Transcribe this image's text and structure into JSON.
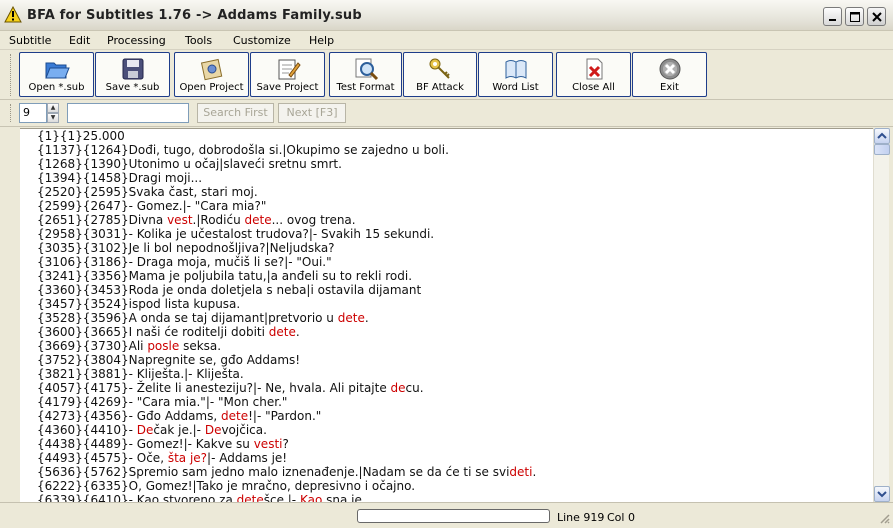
{
  "window": {
    "title": "BFA for Subtitles 1.76 -> Addams Family.sub"
  },
  "menu": [
    "Subtitle",
    "Edit",
    "Processing",
    "Tools",
    "Customize",
    "Help"
  ],
  "toolbar": {
    "buttons": [
      {
        "label": "Open *.sub",
        "icon": "folder-open-icon"
      },
      {
        "label": "Save *.sub",
        "icon": "floppy-disk-icon"
      },
      {
        "label": "Open Project",
        "icon": "open-project-icon"
      },
      {
        "label": "Save Project",
        "icon": "save-project-icon"
      },
      {
        "label": "Test Format",
        "icon": "magnifier-icon"
      },
      {
        "label": "BF Attack",
        "icon": "key-icon"
      },
      {
        "label": "Word List",
        "icon": "book-icon"
      },
      {
        "label": "Close All",
        "icon": "close-document-icon"
      },
      {
        "label": "Exit",
        "icon": "exit-icon"
      }
    ]
  },
  "search": {
    "spin_value": "9",
    "query": "",
    "search_first_label": "Search First",
    "next_label": "Next [F3]"
  },
  "editor": {
    "lines": [
      [
        {
          "t": "{1}{1}25.000"
        }
      ],
      [
        {
          "t": "{1137}{1264}Dođi, tugo, dobrodošla si.|Okupimo se zajedno u boli."
        }
      ],
      [
        {
          "t": "{1268}{1390}Utonimo u očaj|slaveći sretnu smrt."
        }
      ],
      [
        {
          "t": "{1394}{1458}Dragi moji..."
        }
      ],
      [
        {
          "t": "{2520}{2595}Svaka čast, stari moj."
        }
      ],
      [
        {
          "t": "{2599}{2647}- Gomez.|- \"Cara mia?\""
        }
      ],
      [
        {
          "t": "{2651}{2785}Divna "
        },
        {
          "t": "vest",
          "h": true
        },
        {
          "t": ".|Rodiću "
        },
        {
          "t": "dete",
          "h": true
        },
        {
          "t": "... ovog trena."
        }
      ],
      [
        {
          "t": "{2958}{3031}- Kolika je učestalost trudova?|- Svakih 15 sekundi."
        }
      ],
      [
        {
          "t": "{3035}{3102}Je li bol nepodnošljiva?|Neljudska?"
        }
      ],
      [
        {
          "t": "{3106}{3186}- Draga moja, mučiš li se?|- \"Oui.\""
        }
      ],
      [
        {
          "t": "{3241}{3356}Mama je poljubila tatu,|a anđeli su to rekli rodi."
        }
      ],
      [
        {
          "t": "{3360}{3453}Roda je onda doletjela s neba|i ostavila dijamant"
        }
      ],
      [
        {
          "t": "{3457}{3524}ispod lista kupusa."
        }
      ],
      [
        {
          "t": "{3528}{3596}A onda se taj dijamant|pretvorio u "
        },
        {
          "t": "dete",
          "h": true
        },
        {
          "t": "."
        }
      ],
      [
        {
          "t": "{3600}{3665}I naši će roditelji dobiti "
        },
        {
          "t": "dete",
          "h": true
        },
        {
          "t": "."
        }
      ],
      [
        {
          "t": "{3669}{3730}Ali "
        },
        {
          "t": "posle",
          "h": true
        },
        {
          "t": " seksa."
        }
      ],
      [
        {
          "t": "{3752}{3804}Napregnite se, gđo Addams!"
        }
      ],
      [
        {
          "t": "{3821}{3881}- Kliješta.|- Kliješta."
        }
      ],
      [
        {
          "t": "{4057}{4175}- Želite li anesteziju?|- Ne, hvala. Ali pitajte "
        },
        {
          "t": "de",
          "h": true
        },
        {
          "t": "cu."
        }
      ],
      [
        {
          "t": "{4179}{4269}- \"Cara mia.\"|- \"Mon cher.\""
        }
      ],
      [
        {
          "t": "{4273}{4356}- Gđo Addams, "
        },
        {
          "t": "dete",
          "h": true
        },
        {
          "t": "!|- \"Pardon.\""
        }
      ],
      [
        {
          "t": "{4360}{4410}- "
        },
        {
          "t": "De",
          "h": true
        },
        {
          "t": "čak je.|- "
        },
        {
          "t": "De",
          "h": true
        },
        {
          "t": "vojčica."
        }
      ],
      [
        {
          "t": "{4438}{4489}- Gomez!|- Kakve su "
        },
        {
          "t": "vesti",
          "h": true
        },
        {
          "t": "?"
        }
      ],
      [
        {
          "t": "{4493}{4575}- Oče, "
        },
        {
          "t": "šta je?",
          "h": true
        },
        {
          "t": "|- Addams je!"
        }
      ],
      [
        {
          "t": "{5636}{5762}Spremio sam jedno malo iznenađenje.|Nadam se da će ti se svi"
        },
        {
          "t": "deti",
          "h": true
        },
        {
          "t": "."
        }
      ],
      [
        {
          "t": "{6222}{6335}O, Gomez!|Tako je mračno, depresivno i očajno."
        }
      ],
      [
        {
          "t": "{6339}{6410}- Kao stvoreno za "
        },
        {
          "t": "dete",
          "h": true
        },
        {
          "t": "šce.|- "
        },
        {
          "t": "Kao",
          "h": true
        },
        {
          "t": " sna je."
        }
      ]
    ]
  },
  "status": {
    "progress": 0,
    "line": "Line 919",
    "col": "Col 0"
  },
  "colors": {
    "highlight": "#cc0000",
    "button_border": "#1e3d8a",
    "chrome": "#ece9d8"
  }
}
